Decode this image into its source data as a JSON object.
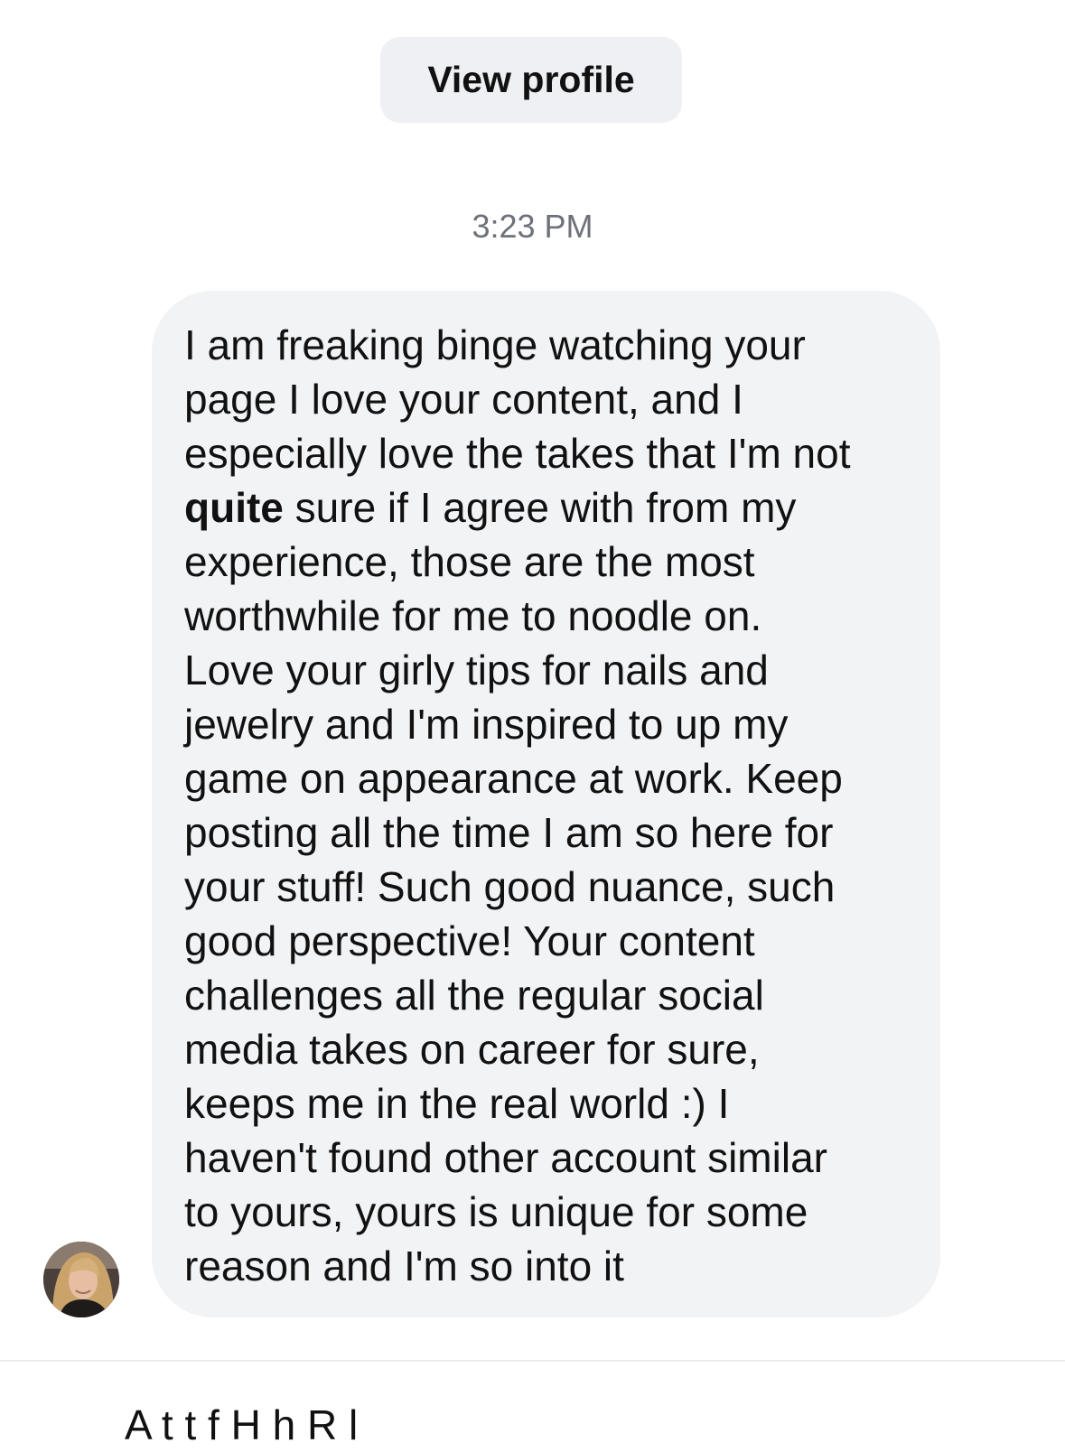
{
  "header": {
    "view_profile_label": "View profile"
  },
  "conversation": {
    "timestamp": "3:23 PM",
    "message": {
      "lines": [
        "I am freaking binge watching your",
        "page I love your content, and I",
        "especially love the takes that I'm not",
        "",
        "experience, those are the most",
        "worthwhile for me to noodle on.",
        "Love your girly tips for nails and",
        "jewelry and I'm inspired to up my",
        "game on appearance at work. Keep",
        "posting all the time I am so here for",
        "your stuff! Such good nuance, such",
        "good perspective! Your content",
        "challenges all the regular social",
        "media takes on career for sure,",
        "keeps me in the real world :) I",
        "haven't found other account similar",
        "to yours, yours is unique for some",
        "reason and I'm so into it"
      ],
      "line4_bold": "quite",
      "line4_rest": " sure if I agree with from my"
    }
  },
  "footer": {
    "partial_text": "A        t                                    t f     H       h R    l"
  }
}
